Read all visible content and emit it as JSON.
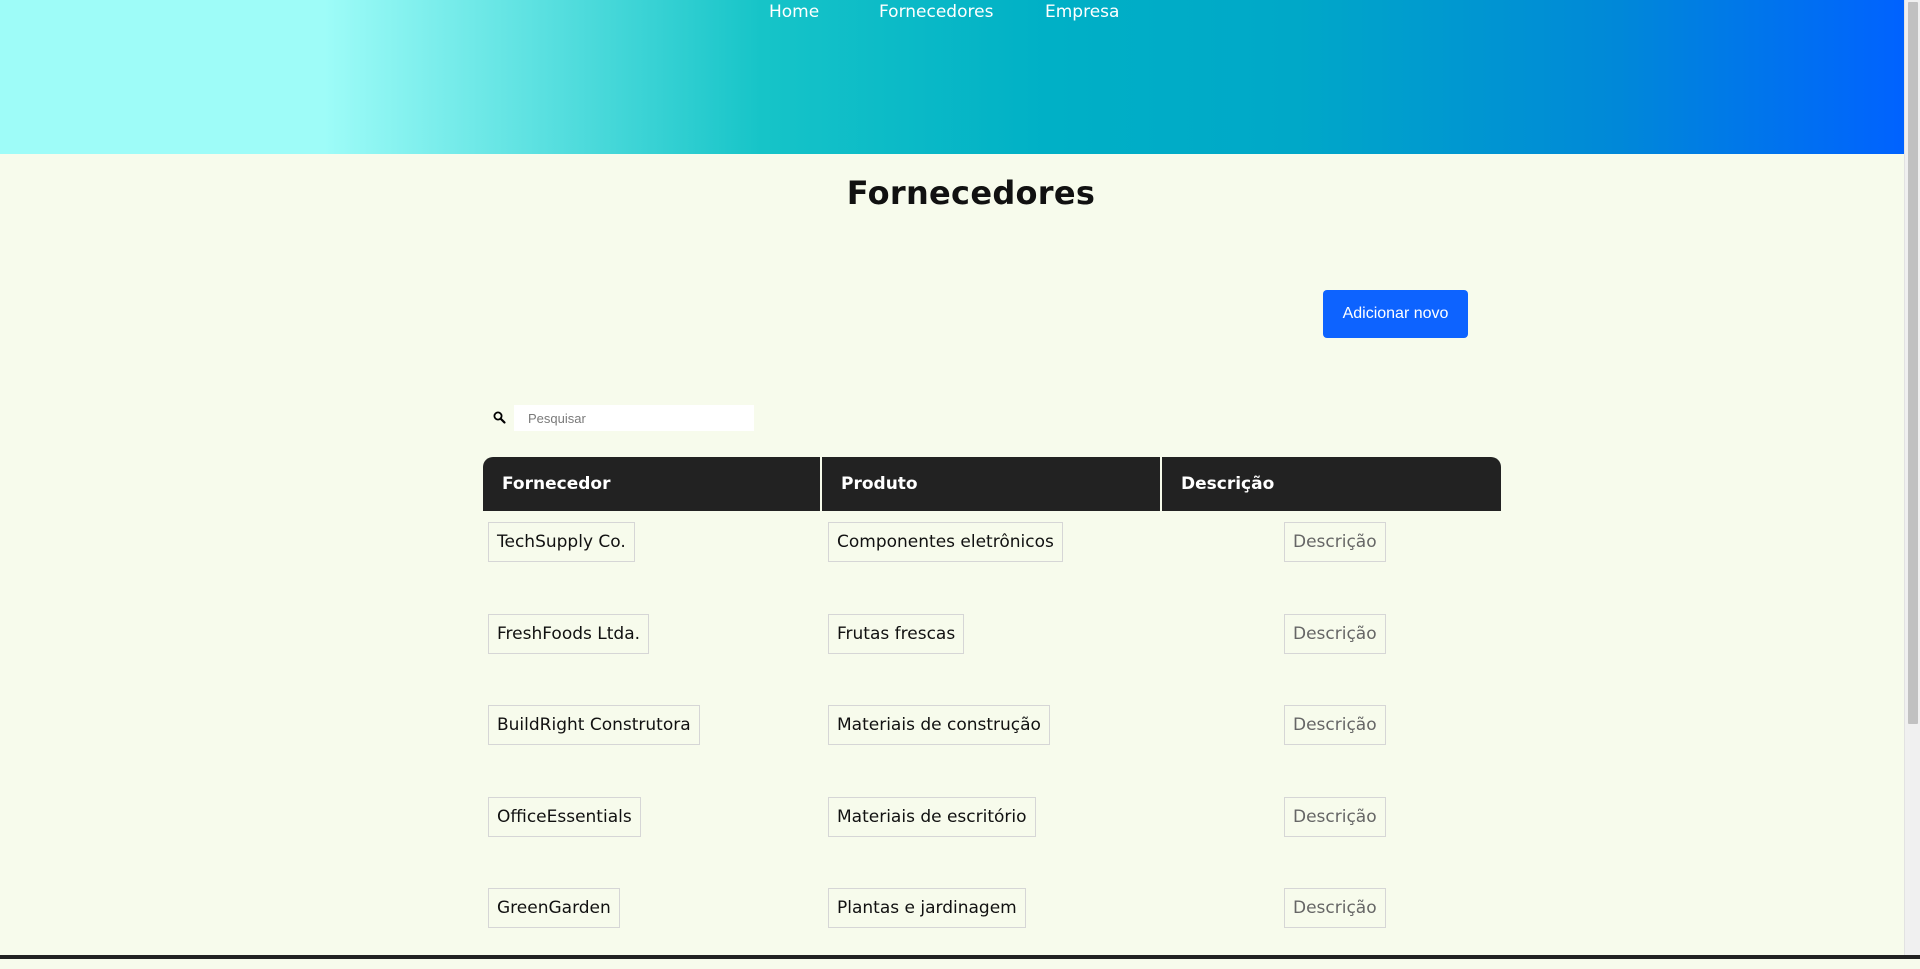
{
  "nav": {
    "home": "Home",
    "suppliers": "Fornecedores",
    "company": "Empresa"
  },
  "page": {
    "title": "Fornecedores",
    "add_button": "Adicionar novo"
  },
  "search": {
    "placeholder": "Pesquisar",
    "value": "",
    "icon": "search-icon"
  },
  "table": {
    "headers": [
      "Fornecedor",
      "Produto",
      "Descrição"
    ],
    "rows": [
      {
        "supplier": "TechSupply Co.",
        "product": "Componentes eletrônicos",
        "description": "Descrição"
      },
      {
        "supplier": "FreshFoods Ltda.",
        "product": "Frutas frescas",
        "description": "Descrição"
      },
      {
        "supplier": "BuildRight Construtora",
        "product": "Materiais de construção",
        "description": "Descrição"
      },
      {
        "supplier": "OfficeEssentials",
        "product": "Materiais de escritório",
        "description": "Descrição"
      },
      {
        "supplier": "GreenGarden",
        "product": "Plantas e jardinagem",
        "description": "Descrição"
      }
    ]
  },
  "colors": {
    "background": "#f7fbec",
    "header_start": "#9efcf8",
    "header_end": "#0062ff",
    "accent_button": "#0d63ff",
    "table_header": "#222222"
  }
}
